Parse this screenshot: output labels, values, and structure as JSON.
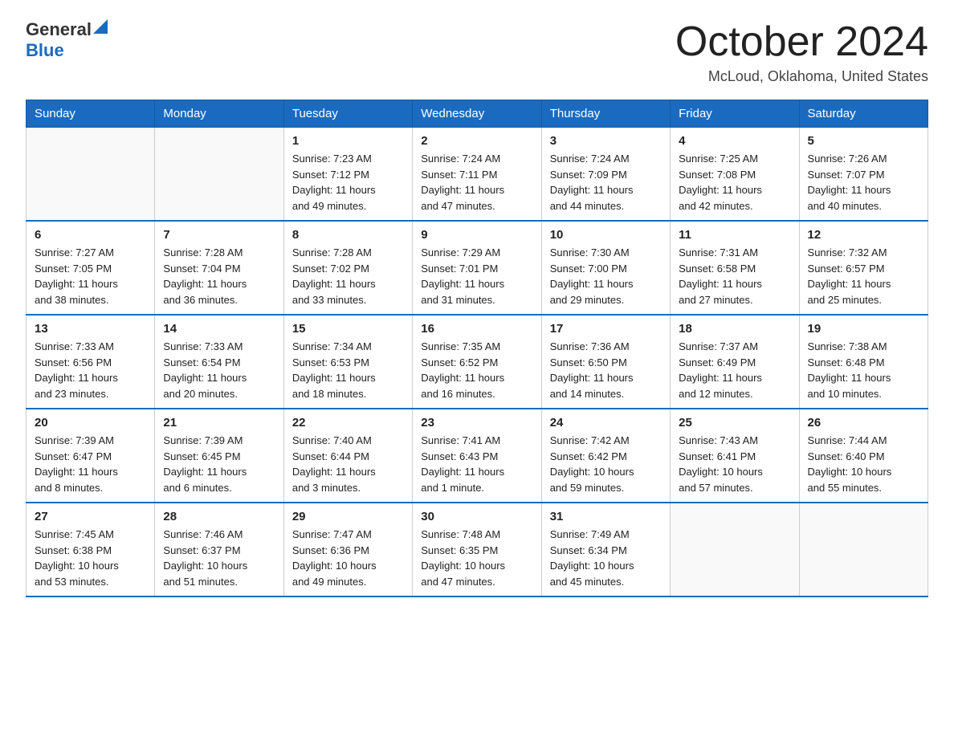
{
  "header": {
    "logo": {
      "general": "General",
      "blue": "Blue"
    },
    "title": "October 2024",
    "location": "McLoud, Oklahoma, United States"
  },
  "calendar": {
    "days_of_week": [
      "Sunday",
      "Monday",
      "Tuesday",
      "Wednesday",
      "Thursday",
      "Friday",
      "Saturday"
    ],
    "weeks": [
      [
        {
          "day": "",
          "info": ""
        },
        {
          "day": "",
          "info": ""
        },
        {
          "day": "1",
          "info": "Sunrise: 7:23 AM\nSunset: 7:12 PM\nDaylight: 11 hours\nand 49 minutes."
        },
        {
          "day": "2",
          "info": "Sunrise: 7:24 AM\nSunset: 7:11 PM\nDaylight: 11 hours\nand 47 minutes."
        },
        {
          "day": "3",
          "info": "Sunrise: 7:24 AM\nSunset: 7:09 PM\nDaylight: 11 hours\nand 44 minutes."
        },
        {
          "day": "4",
          "info": "Sunrise: 7:25 AM\nSunset: 7:08 PM\nDaylight: 11 hours\nand 42 minutes."
        },
        {
          "day": "5",
          "info": "Sunrise: 7:26 AM\nSunset: 7:07 PM\nDaylight: 11 hours\nand 40 minutes."
        }
      ],
      [
        {
          "day": "6",
          "info": "Sunrise: 7:27 AM\nSunset: 7:05 PM\nDaylight: 11 hours\nand 38 minutes."
        },
        {
          "day": "7",
          "info": "Sunrise: 7:28 AM\nSunset: 7:04 PM\nDaylight: 11 hours\nand 36 minutes."
        },
        {
          "day": "8",
          "info": "Sunrise: 7:28 AM\nSunset: 7:02 PM\nDaylight: 11 hours\nand 33 minutes."
        },
        {
          "day": "9",
          "info": "Sunrise: 7:29 AM\nSunset: 7:01 PM\nDaylight: 11 hours\nand 31 minutes."
        },
        {
          "day": "10",
          "info": "Sunrise: 7:30 AM\nSunset: 7:00 PM\nDaylight: 11 hours\nand 29 minutes."
        },
        {
          "day": "11",
          "info": "Sunrise: 7:31 AM\nSunset: 6:58 PM\nDaylight: 11 hours\nand 27 minutes."
        },
        {
          "day": "12",
          "info": "Sunrise: 7:32 AM\nSunset: 6:57 PM\nDaylight: 11 hours\nand 25 minutes."
        }
      ],
      [
        {
          "day": "13",
          "info": "Sunrise: 7:33 AM\nSunset: 6:56 PM\nDaylight: 11 hours\nand 23 minutes."
        },
        {
          "day": "14",
          "info": "Sunrise: 7:33 AM\nSunset: 6:54 PM\nDaylight: 11 hours\nand 20 minutes."
        },
        {
          "day": "15",
          "info": "Sunrise: 7:34 AM\nSunset: 6:53 PM\nDaylight: 11 hours\nand 18 minutes."
        },
        {
          "day": "16",
          "info": "Sunrise: 7:35 AM\nSunset: 6:52 PM\nDaylight: 11 hours\nand 16 minutes."
        },
        {
          "day": "17",
          "info": "Sunrise: 7:36 AM\nSunset: 6:50 PM\nDaylight: 11 hours\nand 14 minutes."
        },
        {
          "day": "18",
          "info": "Sunrise: 7:37 AM\nSunset: 6:49 PM\nDaylight: 11 hours\nand 12 minutes."
        },
        {
          "day": "19",
          "info": "Sunrise: 7:38 AM\nSunset: 6:48 PM\nDaylight: 11 hours\nand 10 minutes."
        }
      ],
      [
        {
          "day": "20",
          "info": "Sunrise: 7:39 AM\nSunset: 6:47 PM\nDaylight: 11 hours\nand 8 minutes."
        },
        {
          "day": "21",
          "info": "Sunrise: 7:39 AM\nSunset: 6:45 PM\nDaylight: 11 hours\nand 6 minutes."
        },
        {
          "day": "22",
          "info": "Sunrise: 7:40 AM\nSunset: 6:44 PM\nDaylight: 11 hours\nand 3 minutes."
        },
        {
          "day": "23",
          "info": "Sunrise: 7:41 AM\nSunset: 6:43 PM\nDaylight: 11 hours\nand 1 minute."
        },
        {
          "day": "24",
          "info": "Sunrise: 7:42 AM\nSunset: 6:42 PM\nDaylight: 10 hours\nand 59 minutes."
        },
        {
          "day": "25",
          "info": "Sunrise: 7:43 AM\nSunset: 6:41 PM\nDaylight: 10 hours\nand 57 minutes."
        },
        {
          "day": "26",
          "info": "Sunrise: 7:44 AM\nSunset: 6:40 PM\nDaylight: 10 hours\nand 55 minutes."
        }
      ],
      [
        {
          "day": "27",
          "info": "Sunrise: 7:45 AM\nSunset: 6:38 PM\nDaylight: 10 hours\nand 53 minutes."
        },
        {
          "day": "28",
          "info": "Sunrise: 7:46 AM\nSunset: 6:37 PM\nDaylight: 10 hours\nand 51 minutes."
        },
        {
          "day": "29",
          "info": "Sunrise: 7:47 AM\nSunset: 6:36 PM\nDaylight: 10 hours\nand 49 minutes."
        },
        {
          "day": "30",
          "info": "Sunrise: 7:48 AM\nSunset: 6:35 PM\nDaylight: 10 hours\nand 47 minutes."
        },
        {
          "day": "31",
          "info": "Sunrise: 7:49 AM\nSunset: 6:34 PM\nDaylight: 10 hours\nand 45 minutes."
        },
        {
          "day": "",
          "info": ""
        },
        {
          "day": "",
          "info": ""
        }
      ]
    ]
  }
}
